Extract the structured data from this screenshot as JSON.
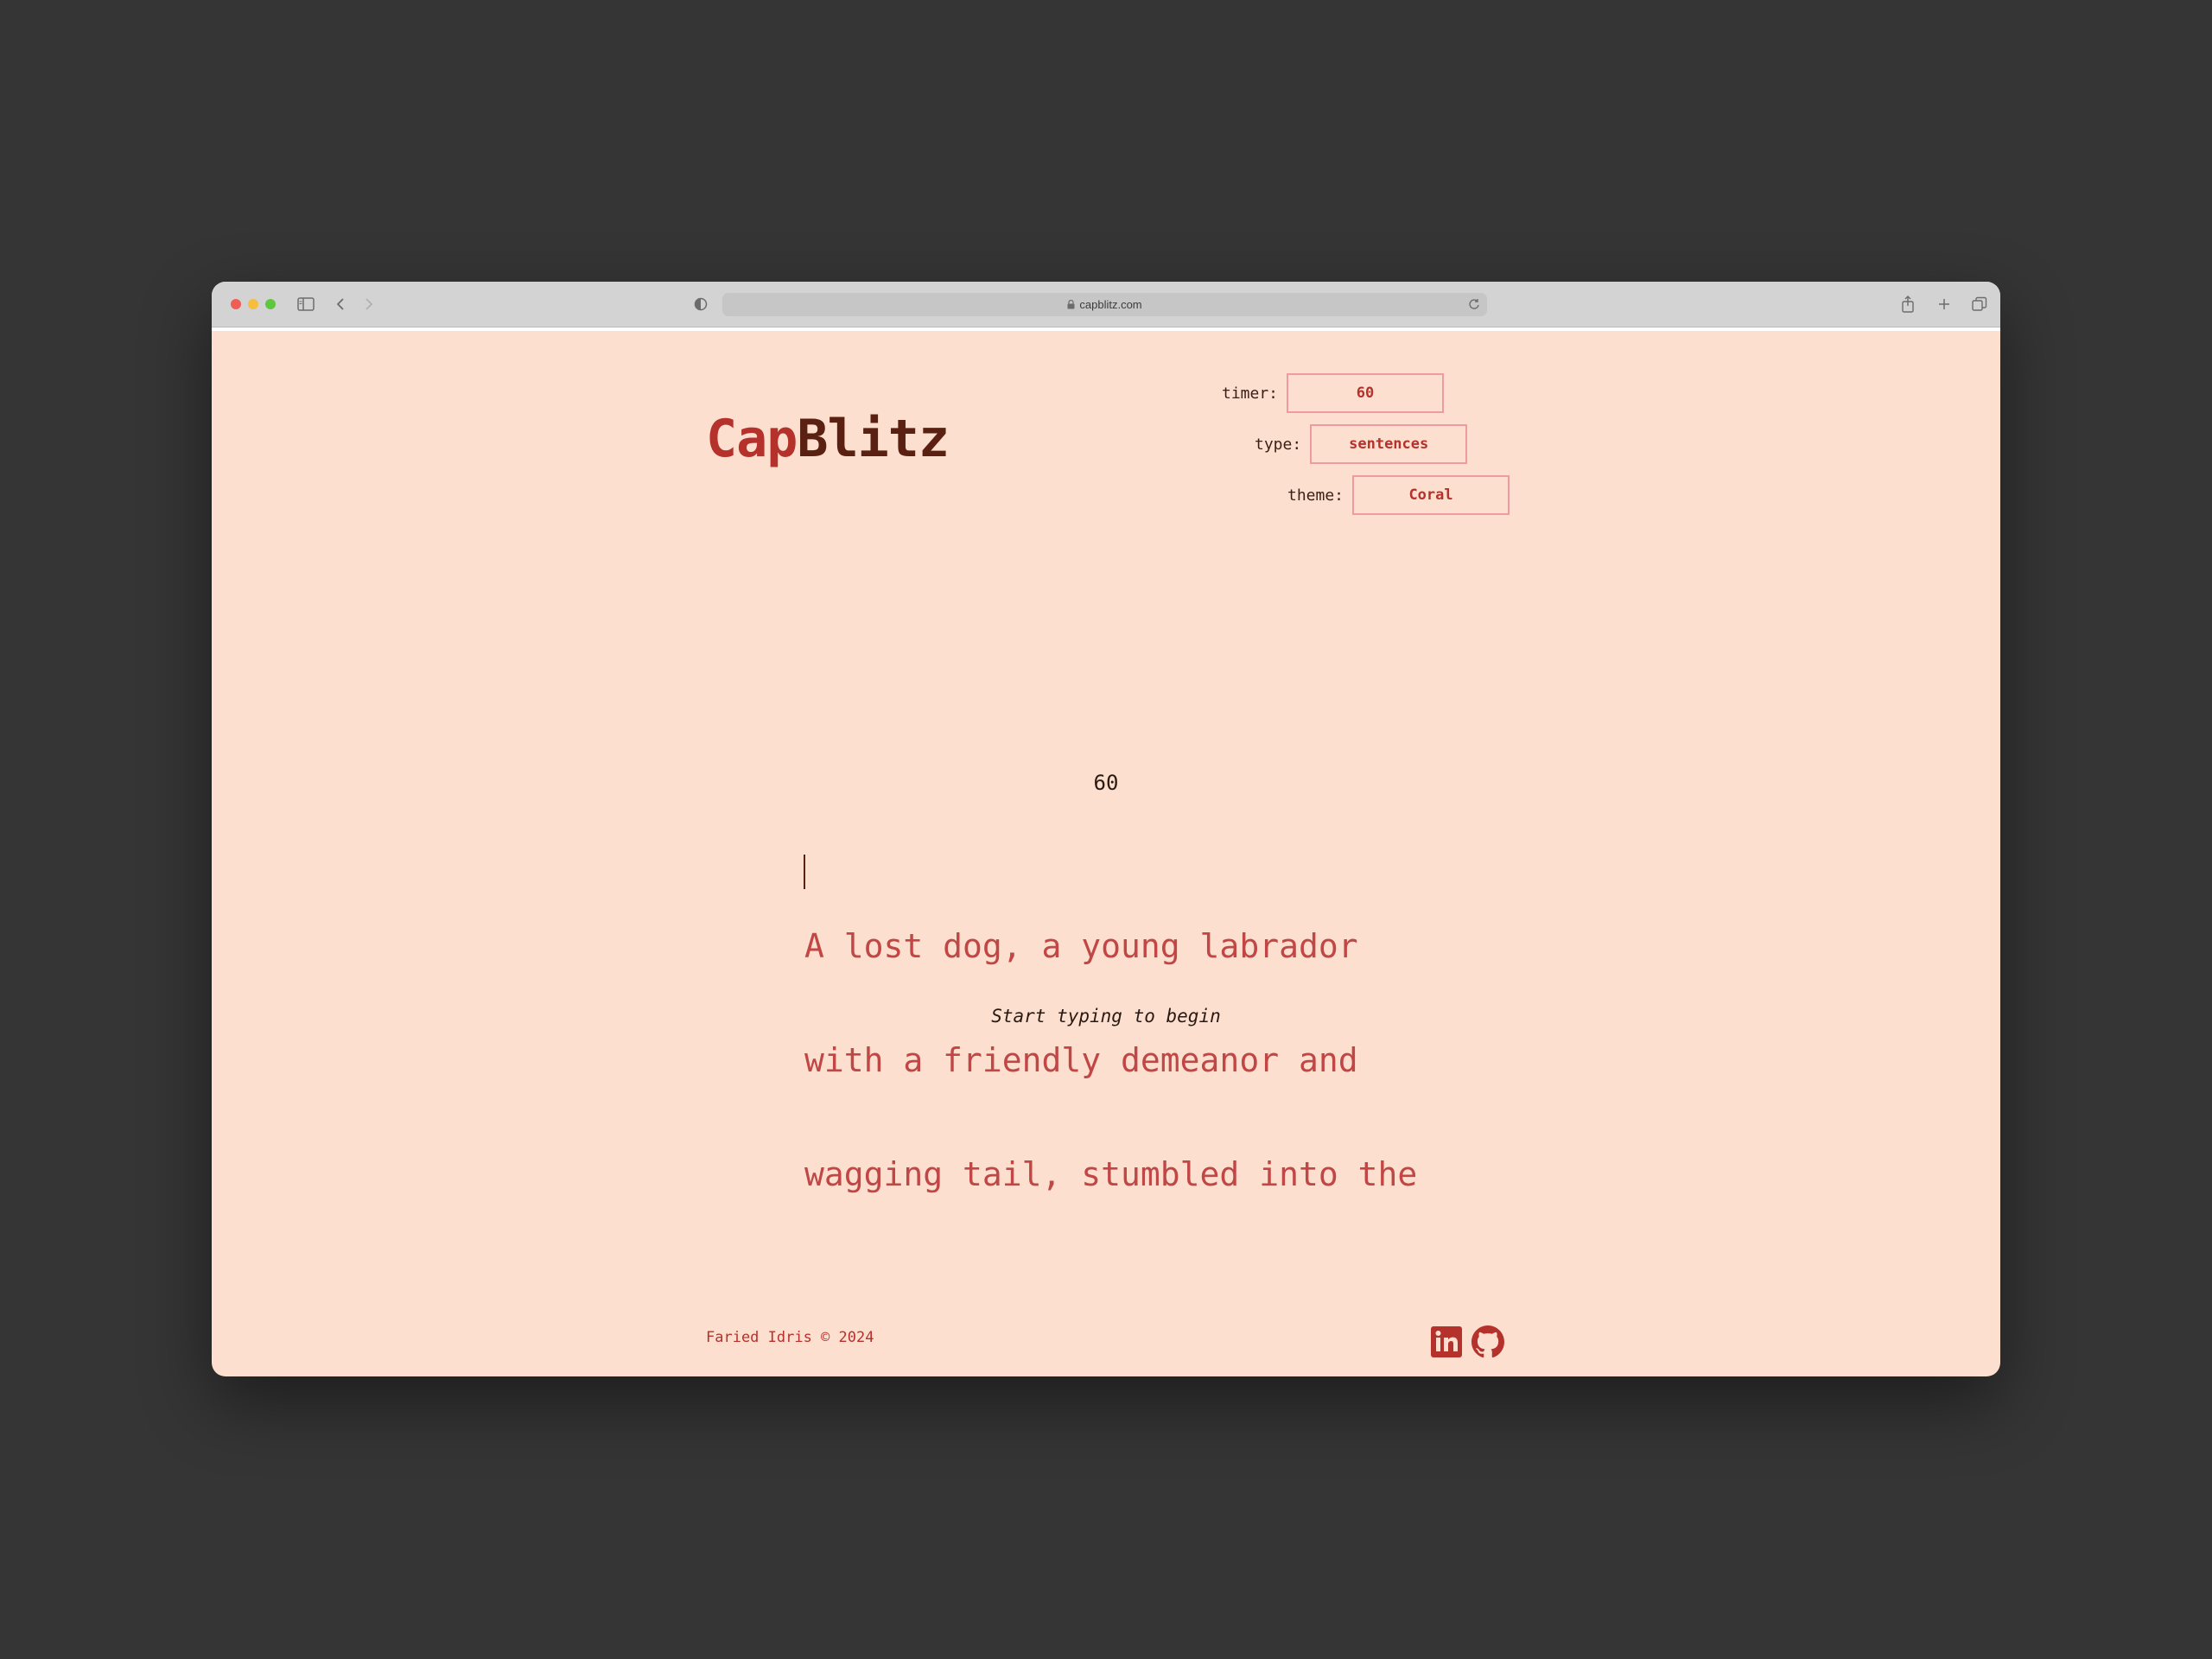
{
  "browser": {
    "url": "capblitz.com"
  },
  "logo": {
    "part1": "Cap",
    "part2": "Blitz"
  },
  "settings": {
    "timer": {
      "label": "timer:",
      "value": "60"
    },
    "type": {
      "label": "type:",
      "value": "sentences"
    },
    "theme": {
      "label": "theme:",
      "value": "Coral"
    }
  },
  "countdown": "60",
  "text_lines": [
    "A lost dog, a young labrador",
    "with a friendly demeanor and",
    "wagging tail, stumbled into the"
  ],
  "hint": "Start typing to begin",
  "footer": {
    "copyright": "Faried Idris © 2024",
    "links": [
      "linkedin-icon",
      "github-icon"
    ]
  },
  "colors": {
    "background": "#fddfcf",
    "accent": "#b5322c",
    "dark": "#5a2112",
    "box_border": "#ef9aa0"
  }
}
